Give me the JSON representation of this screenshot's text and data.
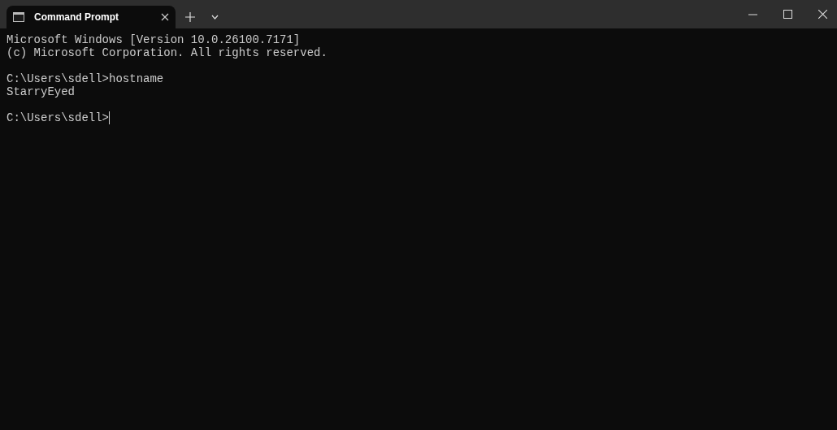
{
  "tabs": [
    {
      "title": "Command Prompt",
      "selected": true
    }
  ],
  "terminal": {
    "blocks": [
      [
        "Microsoft Windows [Version 10.0.26100.7171]",
        "(c) Microsoft Corporation. All rights reserved."
      ],
      [
        "C:\\Users\\sdell>hostname",
        "StarryEyed"
      ],
      [
        "C:\\Users\\sdell>"
      ]
    ],
    "cursor_visible": true
  }
}
